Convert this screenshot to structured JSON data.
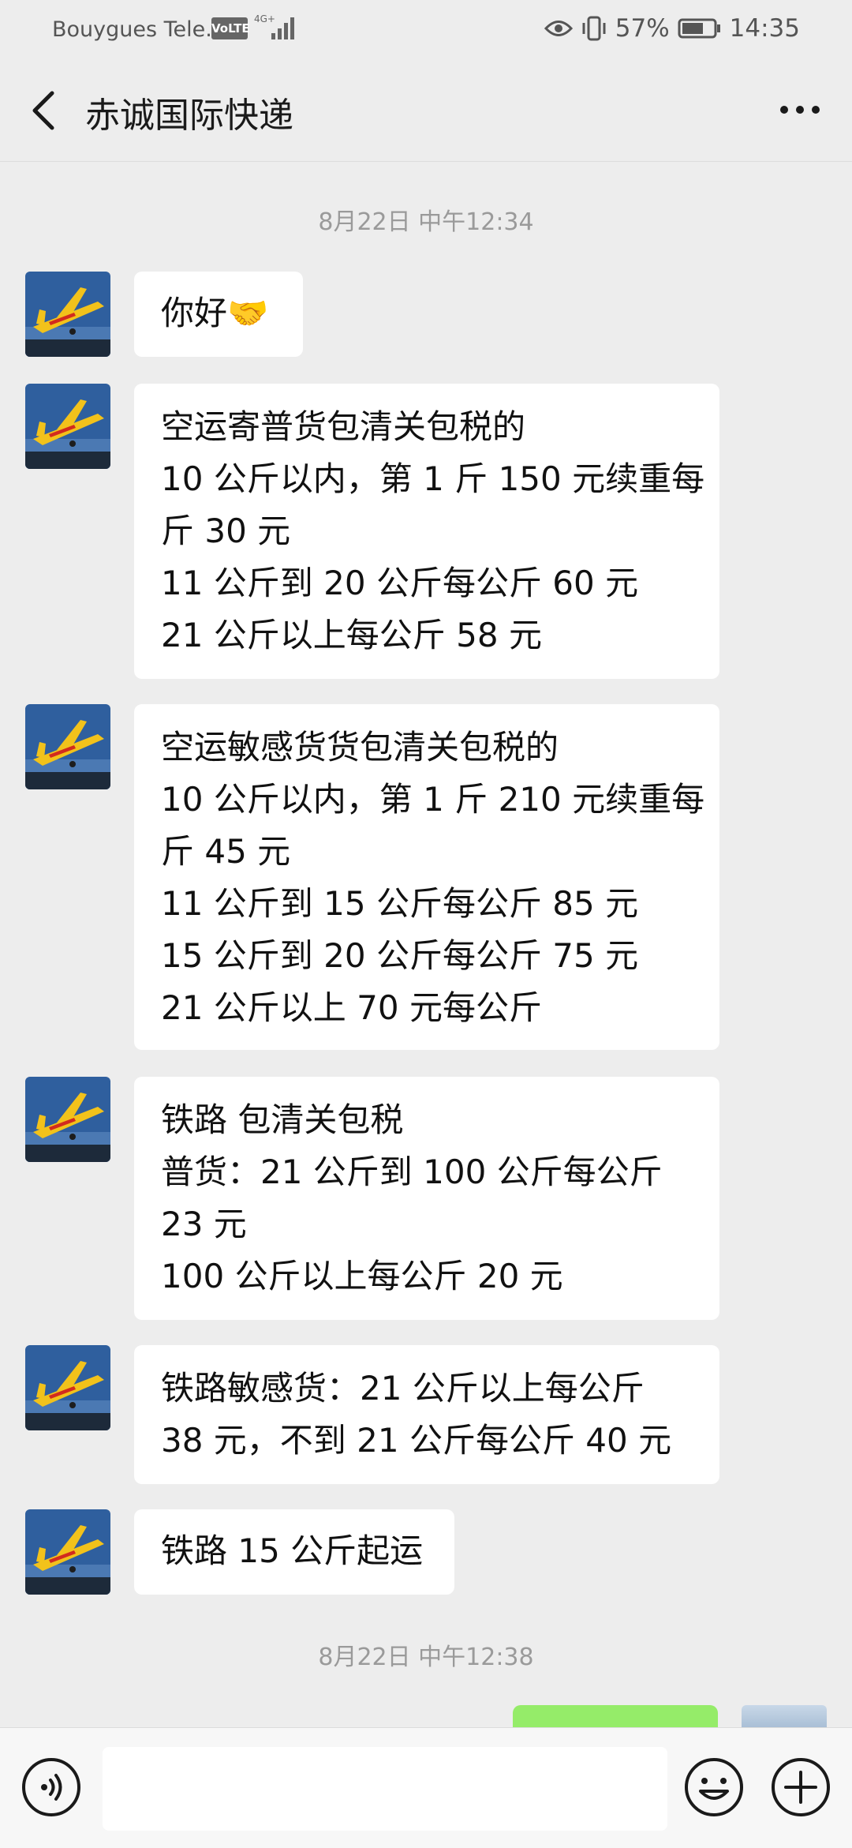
{
  "status_bar": {
    "carrier": "Bouygues Tele...",
    "network_badge": "VoLTE",
    "network_type": "4G+",
    "battery": "57%",
    "time": "14:35"
  },
  "header": {
    "title": "赤诚国际快递"
  },
  "timestamps": [
    "8月22日 中午12:34",
    "8月22日 中午12:38"
  ],
  "messages": [
    {
      "sender": "contact",
      "lines": [
        "你好🤝"
      ]
    },
    {
      "sender": "contact",
      "lines": [
        "空运寄普货包清关包税的",
        "10 公斤以内，第 1 斤 150 元续重每",
        "斤 30 元",
        "11 公斤到 20 公斤每公斤 60 元",
        "21 公斤以上每公斤 58 元"
      ]
    },
    {
      "sender": "contact",
      "lines": [
        "空运敏感货货包清关包税的",
        "10 公斤以内，第 1 斤 210 元续重每",
        "斤 45 元",
        "11 公斤到 15 公斤每公斤 85 元",
        "15 公斤到 20 公斤每公斤 75 元",
        "21 公斤以上 70 元每公斤"
      ]
    },
    {
      "sender": "contact",
      "lines": [
        "铁路 包清关包税",
        "普货：21 公斤到 100 公斤每公斤",
        "23 元",
        "100 公斤以上每公斤 20 元"
      ]
    },
    {
      "sender": "contact",
      "lines": [
        "铁路敏感货：21 公斤以上每公斤",
        "38 元，不到 21 公斤每公斤 40 元"
      ]
    },
    {
      "sender": "contact",
      "lines": [
        "铁路 15 公斤起运"
      ]
    }
  ],
  "colors": {
    "background": "#ededed",
    "bubble": "#ffffff",
    "self_bubble": "#95ec69",
    "timestamp": "#9a9a9a"
  },
  "icons": {
    "back": "chevron-left-icon",
    "more": "more-dots-icon",
    "voice": "voice-icon",
    "emoji": "emoji-icon",
    "plus": "plus-icon",
    "avatar": "airplane-avatar"
  }
}
